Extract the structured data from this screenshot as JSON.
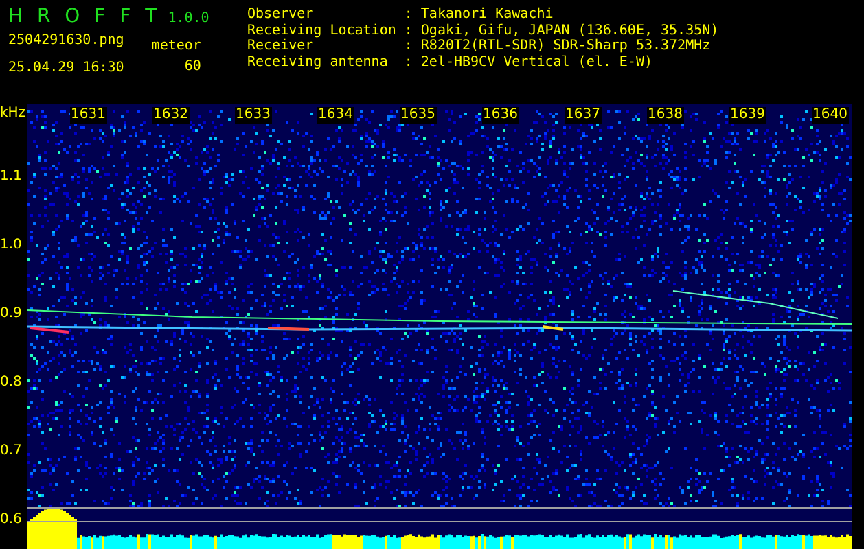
{
  "app": {
    "name": "H R O F F T",
    "version": "1.0.0"
  },
  "file": {
    "filename": "2504291630.png",
    "datetime": "25.04.29 16:30"
  },
  "mode": {
    "label": "meteor",
    "value": "60"
  },
  "station_info": [
    {
      "label": "Observer",
      "separator": ":",
      "value": "Takanori Kawachi"
    },
    {
      "label": "Receiving Location",
      "separator": ":",
      "value": "Ogaki, Gifu, JAPAN (136.60E, 35.35N)"
    },
    {
      "label": "Receiver",
      "separator": ":",
      "value": "R820T2(RTL-SDR) SDR-Sharp 53.372MHz"
    },
    {
      "label": "Receiving antenna",
      "separator": ":",
      "value": "2el-HB9CV Vertical (el. E-W)"
    }
  ],
  "spectrogram": {
    "y_unit": "kHz",
    "x_ticks": [
      "1631",
      "1632",
      "1633",
      "1634",
      "1635",
      "1636",
      "1637",
      "1638",
      "1639",
      "1640"
    ],
    "y_ticks": [
      "1.1",
      "1.0",
      "0.9",
      "0.8",
      "0.7",
      "0.6"
    ]
  }
}
